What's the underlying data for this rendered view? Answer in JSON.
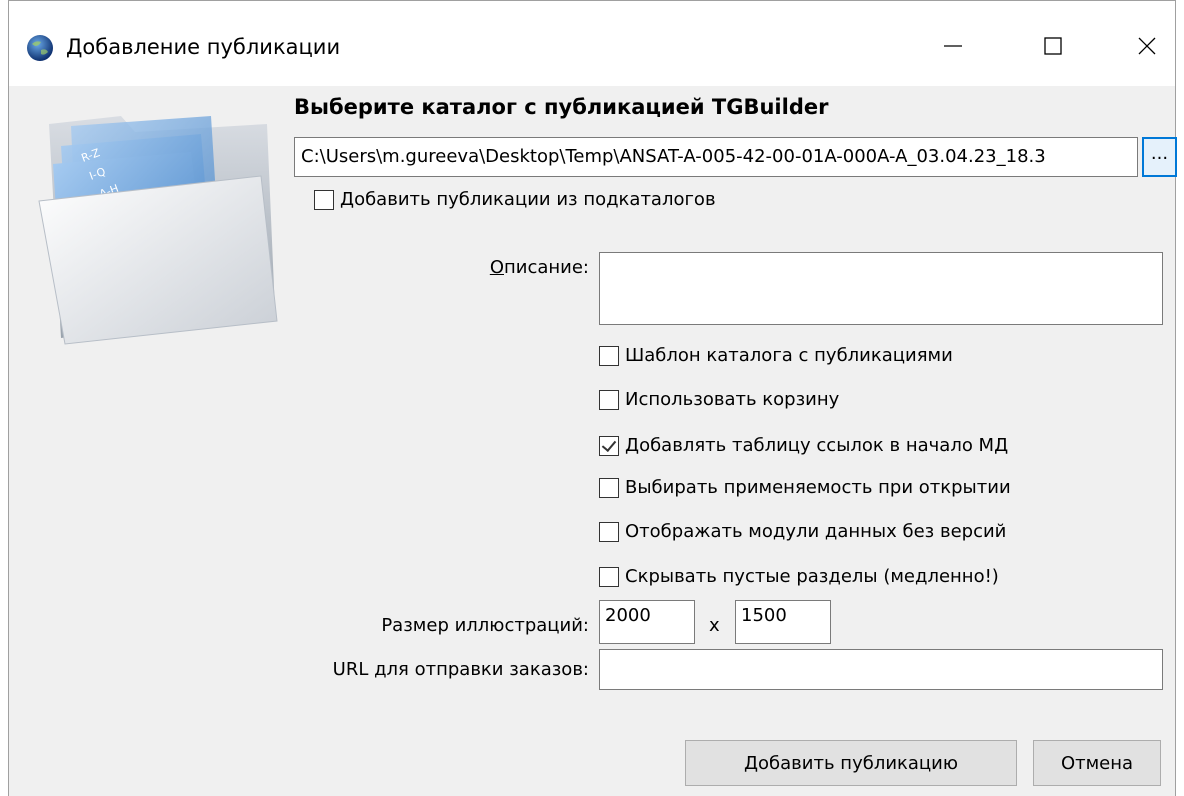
{
  "window": {
    "title": "Добавление публикации"
  },
  "heading": "Выберите каталог с публикацией TGBuilder",
  "path": {
    "value": "C:\\Users\\m.gureeva\\Desktop\\Temp\\ANSAT-A-005-42-00-01A-000A-A_03.04.23_18.3",
    "browse_label": "..."
  },
  "subcatalogs": {
    "label": "Добавить публикации из подкаталогов",
    "checked": false
  },
  "description": {
    "label_underlined": "О",
    "label_rest": "писание:",
    "value": ""
  },
  "options": [
    {
      "label": "Шаблон каталога с публикациями",
      "checked": false
    },
    {
      "label": "Использовать корзину",
      "checked": false
    },
    {
      "label": "Добавлять таблицу ссылок в начало МД",
      "checked": true
    },
    {
      "label": "Выбирать применяемость при открытии",
      "checked": false
    },
    {
      "label": "Отображать модули данных без версий",
      "checked": false
    },
    {
      "label": "Скрывать пустые разделы (медленно!)",
      "checked": false
    }
  ],
  "illustration_size": {
    "label": "Размер иллюстраций:",
    "width": "2000",
    "separator": "x",
    "height": "1500"
  },
  "order_url": {
    "label": "URL для отправки заказов:",
    "value": ""
  },
  "buttons": {
    "add": "Добавить публикацию",
    "cancel": "Отмена"
  },
  "folder_tabs": [
    "R-Z",
    "I-Q",
    "A-H"
  ],
  "icons": {
    "app": "globe-icon",
    "folder": "folder-icon"
  },
  "colors": {
    "accent": "#0078d7",
    "folder_blue": "#4a86c8"
  }
}
